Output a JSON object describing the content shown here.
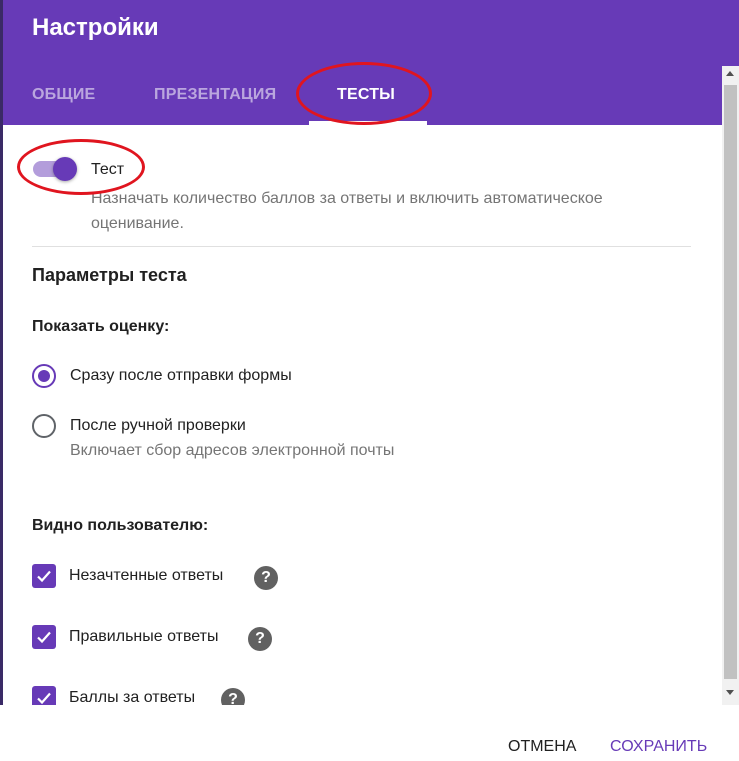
{
  "dialog": {
    "title": "Настройки",
    "tabs": [
      {
        "label": "ОБЩИЕ",
        "active": false
      },
      {
        "label": "ПРЕЗЕНТАЦИЯ",
        "active": false
      },
      {
        "label": "ТЕСТЫ",
        "active": true
      }
    ]
  },
  "quiz": {
    "toggle_on": true,
    "label": "Тест",
    "description": "Назначать количество баллов за ответы и включить автоматическое оценивание."
  },
  "params": {
    "title": "Параметры теста",
    "show_grade": {
      "heading": "Показать оценку:",
      "options": [
        {
          "label": "Сразу после отправки формы",
          "checked": true
        },
        {
          "label": "После ручной проверки",
          "description": "Включает сбор адресов электронной почты",
          "checked": false
        }
      ]
    },
    "visible": {
      "heading": "Видно пользователю:",
      "items": [
        {
          "label": "Незачтенные ответы",
          "checked": true
        },
        {
          "label": "Правильные ответы",
          "checked": true
        },
        {
          "label": "Баллы за ответы",
          "checked": true
        }
      ]
    }
  },
  "footer": {
    "cancel": "ОТМЕНА",
    "save": "СОХРАНИТЬ"
  },
  "colors": {
    "accent": "#673ab7",
    "annotation": "#e0151f"
  },
  "icons": {
    "help": "help-circle-icon",
    "check": "checkmark-icon"
  }
}
